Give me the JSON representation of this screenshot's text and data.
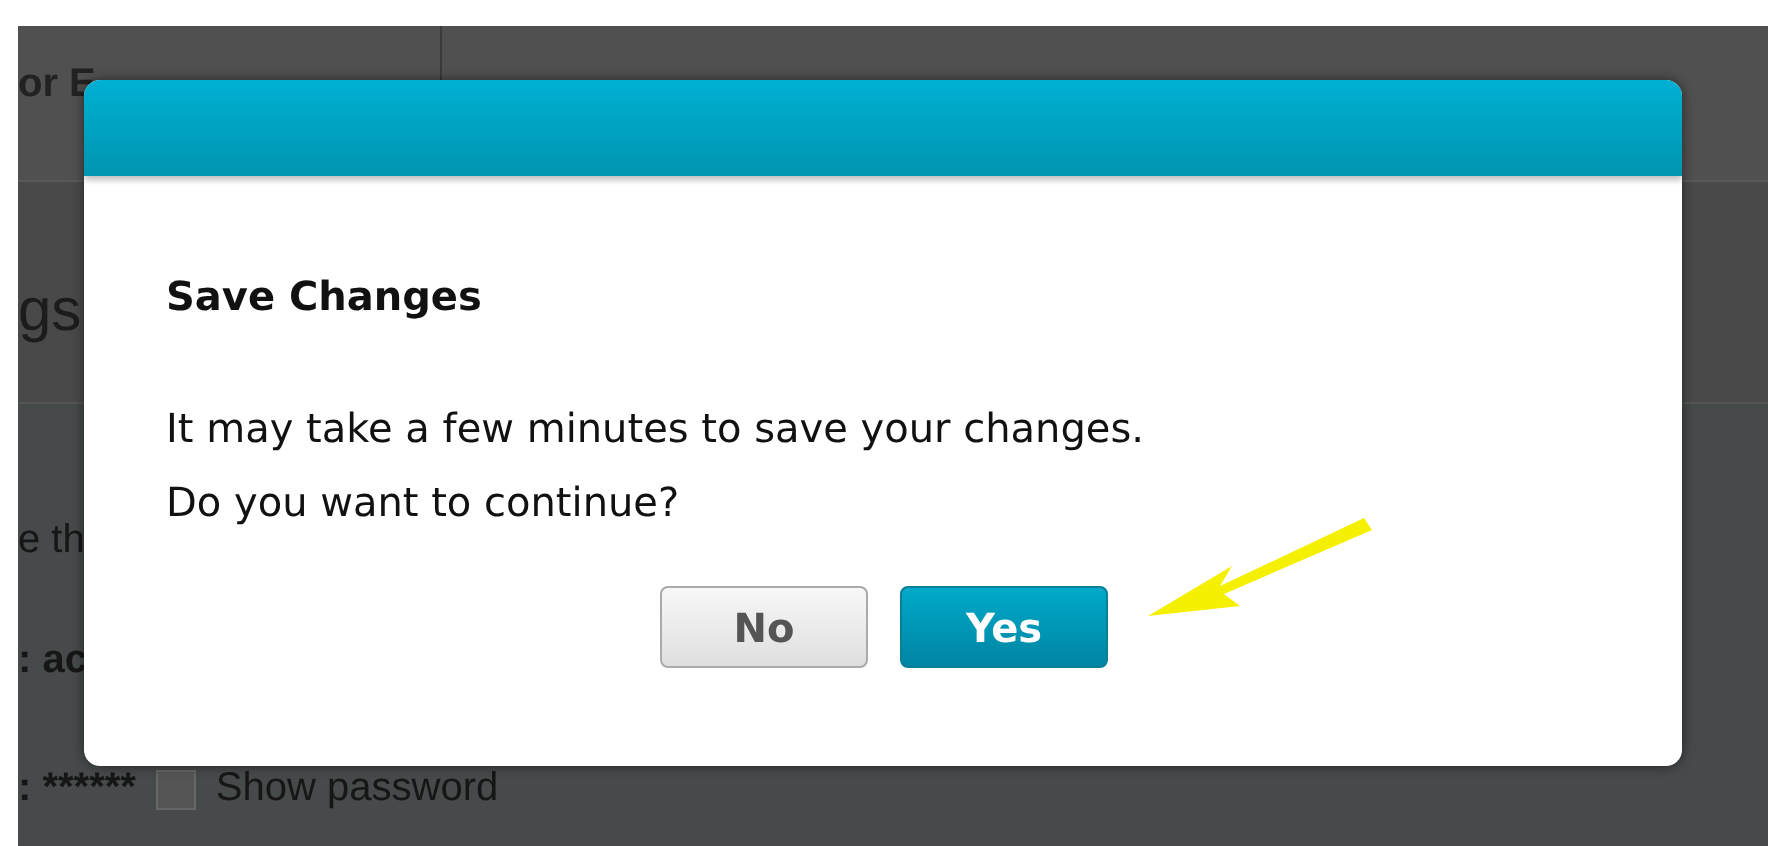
{
  "page": {
    "header_text": "or E",
    "section_heading": "gs",
    "field_1": "e th",
    "field_2": ": ac",
    "password": ": ******",
    "show_password": {
      "label": "Show password",
      "checked": false
    }
  },
  "dialog": {
    "title": "Save Changes",
    "message_lines": [
      "It may take a few minutes to save your changes.",
      "Do you want to continue?"
    ],
    "buttons": [
      {
        "label": "No",
        "kind": "secondary"
      },
      {
        "label": "Yes",
        "kind": "primary"
      }
    ]
  }
}
